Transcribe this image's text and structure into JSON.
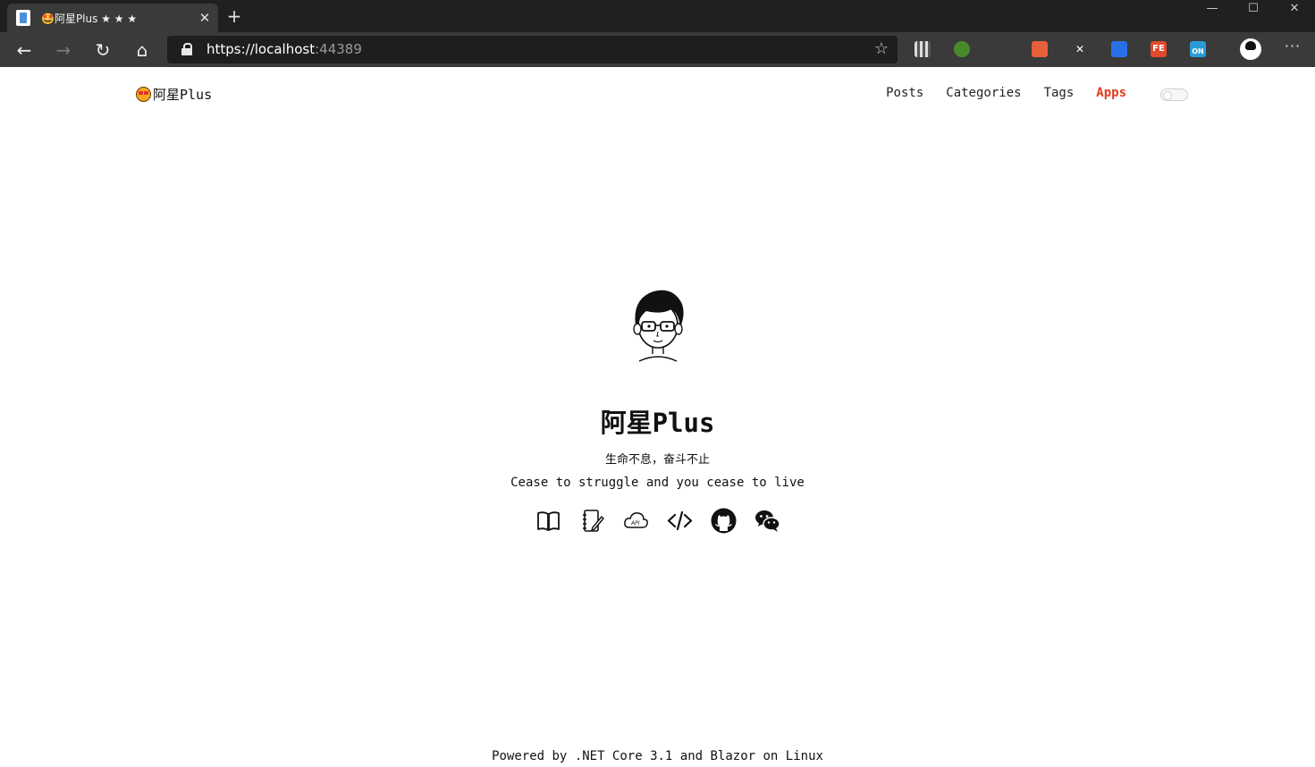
{
  "browser": {
    "tab_title": "🤩阿星Plus ★ ★ ★",
    "close_tab": "✕",
    "new_tab": "+",
    "window_controls": {
      "minimize": "—",
      "maximize": "☐",
      "close": "✕"
    },
    "nav": {
      "back": "←",
      "forward": "→",
      "refresh": "↻",
      "home": "⌂"
    },
    "url_host": "https://localhost",
    "url_port": ":44389",
    "favorite_icon": "☆",
    "menu": "···",
    "extensions": [
      "qr-code-icon",
      "green-leaf-icon",
      "orange-extension-icon",
      "x-extension-icon",
      "blue-download-icon",
      "fe-extension-icon",
      "on-extension-icon"
    ],
    "extension_labels": {
      "x": "✕",
      "fe": "FE",
      "on": "ON"
    }
  },
  "site": {
    "brand_name": "阿星Plus",
    "nav": [
      {
        "label": "Posts",
        "active": false
      },
      {
        "label": "Categories",
        "active": false
      },
      {
        "label": "Tags",
        "active": false
      },
      {
        "label": "Apps",
        "active": true
      }
    ],
    "theme_toggle_on": false
  },
  "hero": {
    "title": "阿星Plus",
    "motto": "生命不息，奋斗不止",
    "subtitle": "Cease to struggle and you cease to live",
    "links": [
      "book-icon",
      "notebook-pen-icon",
      "cloud-api-icon",
      "code-icon",
      "github-icon",
      "wechat-icon"
    ]
  },
  "footer": {
    "text": "Powered by .NET Core 3.1 and Blazor on Linux"
  },
  "colors": {
    "accent": "#e03a1e",
    "text": "#111111",
    "chrome_dark": "#202020",
    "chrome_toolbar": "#3a3a3a"
  }
}
